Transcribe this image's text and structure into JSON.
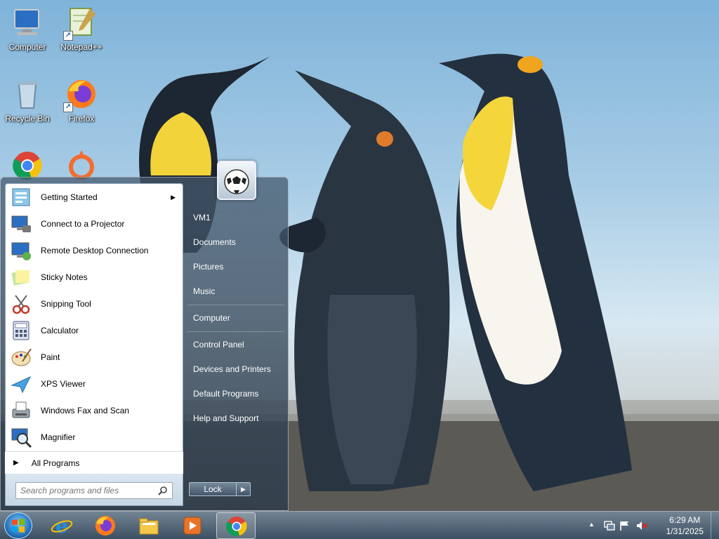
{
  "desktop": {
    "icons": [
      {
        "label": "Computer"
      },
      {
        "label": "Notepad++"
      },
      {
        "label": "Recycle Bin"
      },
      {
        "label": "Firefox"
      },
      {
        "label": "Google Chrome"
      },
      {
        "label": "Origin"
      }
    ]
  },
  "start_menu": {
    "programs": [
      {
        "label": "Getting Started",
        "icon": "getting-started-icon",
        "submenu": true
      },
      {
        "label": "Connect to a Projector",
        "icon": "projector-icon"
      },
      {
        "label": "Remote Desktop Connection",
        "icon": "remote-desktop-icon"
      },
      {
        "label": "Sticky Notes",
        "icon": "sticky-notes-icon"
      },
      {
        "label": "Snipping Tool",
        "icon": "snipping-tool-icon"
      },
      {
        "label": "Calculator",
        "icon": "calculator-icon"
      },
      {
        "label": "Paint",
        "icon": "paint-icon"
      },
      {
        "label": "XPS Viewer",
        "icon": "xps-viewer-icon"
      },
      {
        "label": "Windows Fax and Scan",
        "icon": "fax-scan-icon"
      },
      {
        "label": "Magnifier",
        "icon": "magnifier-icon"
      }
    ],
    "all_programs": "All Programs",
    "search_placeholder": "Search programs and files",
    "places": [
      {
        "label": "VM1"
      },
      {
        "label": "Documents"
      },
      {
        "label": "Pictures"
      },
      {
        "label": "Music"
      },
      {
        "label": "Computer"
      },
      {
        "label": "Control Panel"
      },
      {
        "label": "Devices and Printers"
      },
      {
        "label": "Default Programs"
      },
      {
        "label": "Help and Support"
      }
    ],
    "lock_label": "Lock"
  },
  "taskbar": {
    "time": "6:29 AM",
    "date": "1/31/2025"
  },
  "colors": {
    "accent": "#1a64b3",
    "menu_text": "#ffffff"
  }
}
